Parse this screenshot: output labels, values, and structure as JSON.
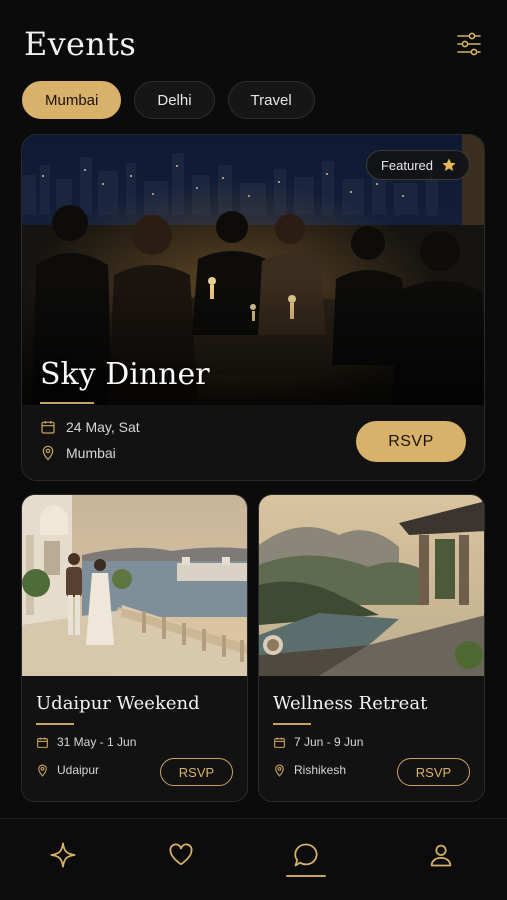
{
  "header": {
    "title": "Events",
    "filter_icon": "sliders-icon"
  },
  "chips": [
    {
      "label": "Mumbai",
      "active": true
    },
    {
      "label": "Delhi",
      "active": false
    },
    {
      "label": "Travel",
      "active": false
    }
  ],
  "featured": {
    "badge": "Featured",
    "title": "Sky Dinner",
    "date": "24 May, Sat",
    "location": "Mumbai",
    "rsvp": "RSVP"
  },
  "events": [
    {
      "title": "Udaipur Weekend",
      "date": "31 May - 1 Jun",
      "location": "Udaipur",
      "rsvp": "RSVP"
    },
    {
      "title": "Wellness Retreat",
      "date": "7 Jun - 9 Jun",
      "location": "Rishikesh",
      "rsvp": "RSVP"
    }
  ],
  "nav": [
    {
      "icon": "sparkle-icon",
      "active": false
    },
    {
      "icon": "heart-icon",
      "active": false
    },
    {
      "icon": "chat-icon",
      "active": true
    },
    {
      "icon": "profile-icon",
      "active": false
    }
  ],
  "colors": {
    "accent": "#d8b26a",
    "background": "#0b0b0b",
    "card": "#121212"
  }
}
